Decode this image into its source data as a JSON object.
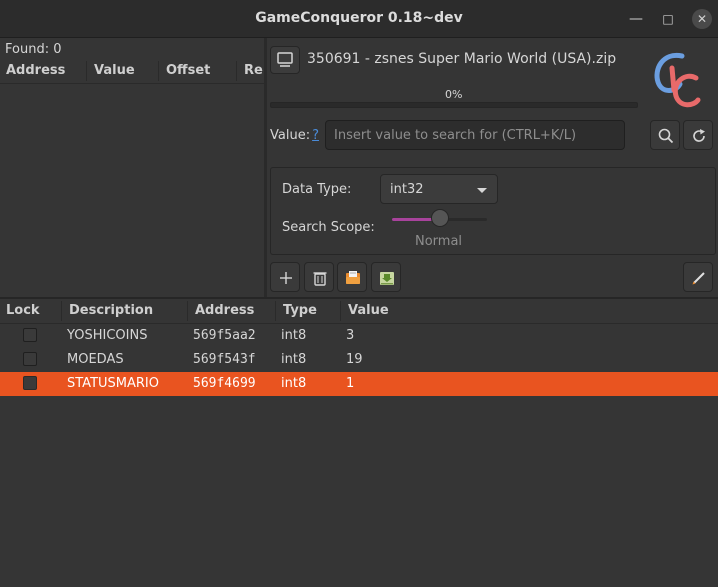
{
  "window": {
    "title": "GameConqueror 0.18~dev",
    "controls": {
      "minimize_icon": "minimize-icon",
      "maximize_icon": "maximize-icon",
      "close_icon": "close-icon"
    }
  },
  "results": {
    "found_label": "Found: 0",
    "columns": [
      "Address",
      "Value",
      "Offset",
      "Re"
    ]
  },
  "process": {
    "name": "350691 - zsnes Super Mario World (USA).zip",
    "progress_text": "0%",
    "progress_fraction": 0.0
  },
  "search": {
    "value_label": "Value:",
    "help_link": "?",
    "placeholder": "Insert value to search for (CTRL+K/L)"
  },
  "options": {
    "data_type_label": "Data Type:",
    "data_type_value": "int32",
    "scope_label": "Search Scope:",
    "scope_value": "Normal",
    "scope_level_fraction": 0.5
  },
  "cheat_list": {
    "columns": [
      "Lock",
      "Description",
      "Address",
      "Type",
      "Value"
    ],
    "rows": [
      {
        "lock": false,
        "description": "YOSHICOINS",
        "address": "569f5aa2",
        "type": "int8",
        "value": "3"
      },
      {
        "lock": false,
        "description": "MOEDAS",
        "address": "569f543f",
        "type": "int8",
        "value": "19"
      },
      {
        "lock": false,
        "description": "STATUSMARIO",
        "address": "569f4699",
        "type": "int8",
        "value": "1",
        "selected": true
      }
    ]
  },
  "colors": {
    "accent": "#e95420",
    "background": "#353535",
    "link": "#4a8bd8",
    "slider_fill": "#a8439c"
  }
}
